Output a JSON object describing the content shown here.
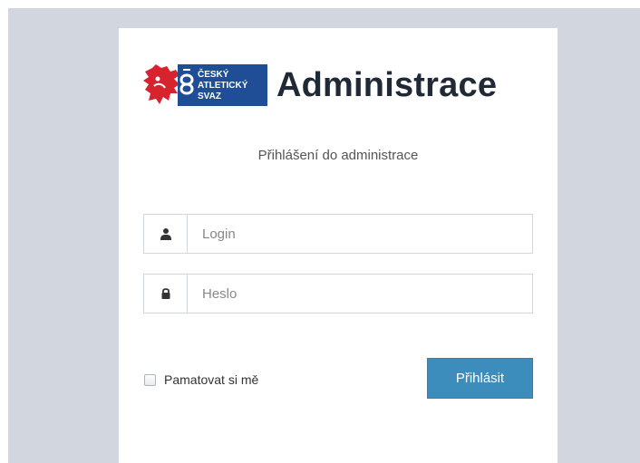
{
  "brand": {
    "logo_text": [
      "ČESKÝ",
      "ATLETICKÝ",
      "SVAZ"
    ],
    "title": "Administrace",
    "colors": {
      "logo_red": "#d7232d",
      "logo_blue": "#1f4e96"
    }
  },
  "login_box": {
    "subtitle": "Přihlášení do administrace",
    "login_field": {
      "icon": "user-icon",
      "placeholder": "Login",
      "value": ""
    },
    "password_field": {
      "icon": "lock-icon",
      "placeholder": "Heslo",
      "value": ""
    },
    "remember_me": {
      "label": "Pamatovat si mě",
      "checked": false
    },
    "submit_label": "Přihlásit"
  },
  "colors": {
    "background": "#d2d6de",
    "card": "#ffffff",
    "button": "#3c8dbc",
    "button_text": "#ffffff",
    "title_text": "#1f2a36"
  }
}
